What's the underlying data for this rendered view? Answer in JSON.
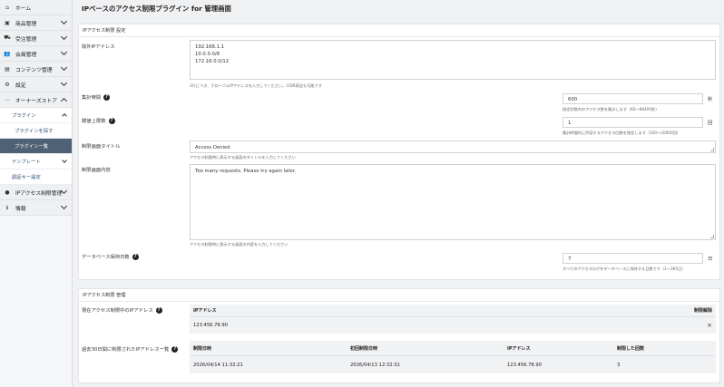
{
  "sidebar": {
    "items": [
      {
        "icon": "home-icon",
        "glyph": "⌂",
        "label": "ホーム"
      },
      {
        "icon": "box-icon",
        "glyph": "▣",
        "label": "商品管理"
      },
      {
        "icon": "cart-icon",
        "glyph": "⛟",
        "label": "受注管理"
      },
      {
        "icon": "users-icon",
        "glyph": "👥",
        "label": "会員管理"
      },
      {
        "icon": "document-icon",
        "glyph": "▤",
        "label": "コンテンツ管理"
      },
      {
        "icon": "gear-icon",
        "glyph": "⚙",
        "label": "設定"
      },
      {
        "icon": "store-icon",
        "glyph": "⋯",
        "label": "オーナーズストア"
      }
    ],
    "owners_sub": {
      "plugin": "プラグイン",
      "plugin_search": "プラグインを探す",
      "plugin_list": "プラグイン一覧",
      "template": "テンプレート",
      "auth_key": "認証キー設定"
    },
    "bottom_items": [
      {
        "icon": "ip-icon",
        "glyph": "●",
        "label": "IPアクセス制限管理"
      },
      {
        "icon": "info-icon",
        "glyph": "ℹ",
        "label": "情報"
      }
    ]
  },
  "page_title": "IPベースのアクセス制限プラグイン for 管理画面",
  "settings_card": {
    "header": "IPアクセス制限 設定",
    "exclude_ip": {
      "label": "除外IPアドレス",
      "value": "192.168.1.1\n10.0.0.0/8\n172.16.0.0/12",
      "hint": "1行につき、グローバルIPアドレスを入力してください。CIDR表記も可能です"
    },
    "period": {
      "label": "集計時間",
      "value": "600",
      "unit": "秒",
      "hint": "指定秒数内のアクセス数を集計します（60～86400秒）"
    },
    "threshold": {
      "label": "閾値上限数",
      "value": "1",
      "unit": "回",
      "hint": "集計時間内に許容するアクセス回数を指定します（100～20000回）"
    },
    "block_title": {
      "label": "制限画面タイトル",
      "value": "Access Denied",
      "hint": "アクセス制限時に表示する画面のタイトルを入力してください"
    },
    "block_content": {
      "label": "制限画面内容",
      "value": "Too many requests. Please try again later.",
      "hint": "アクセス制限時に表示する画面の内容を入力してください"
    },
    "retention": {
      "label": "データベース保持日数",
      "value": "7",
      "unit": "日",
      "hint": "すべてのアクセスログをデータベースに保持する日数です（1～365日）"
    }
  },
  "manage_card": {
    "header": "IPアクセス制限 管理",
    "current": {
      "label": "現在アクセス制限中のIPアドレス",
      "col_ip": "IPアドレス",
      "col_action": "制限解除",
      "rows": [
        {
          "ip": "123.456.78.90",
          "action": "×"
        }
      ]
    },
    "history": {
      "label": "過去30日間に制限されたIPアドレス一覧",
      "columns": [
        "制限日時",
        "初回制限日時",
        "IPアドレス",
        "制限した回数"
      ],
      "rows": [
        [
          "2026/04/14 11:32:21",
          "2026/04/13 12:32:31",
          "123.456.78.90",
          "3"
        ]
      ]
    }
  }
}
